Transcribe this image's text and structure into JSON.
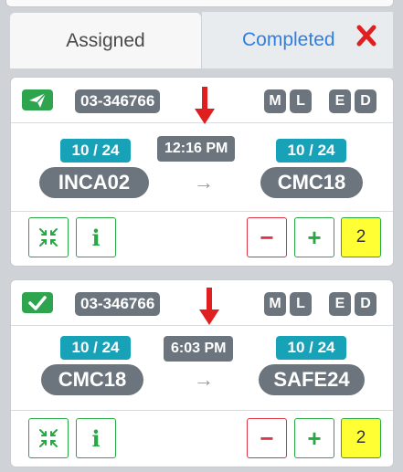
{
  "tabs": {
    "assigned": "Assigned",
    "completed": "Completed"
  },
  "colors": {
    "accent_blue": "#2f7fe0",
    "close_red": "#e02020",
    "status_green": "#2ea44f",
    "badge_gray": "#6c757d",
    "count_teal": "#17a2b8",
    "counter_yellow": "#ffff33"
  },
  "cards": [
    {
      "status_icon": "paper-plane-icon",
      "id": "03-346766",
      "flags": [
        "M",
        "L",
        "E",
        "D"
      ],
      "origin_count": "10 / 24",
      "origin": "INCA02",
      "time": "12:16 PM",
      "dest_count": "10 / 24",
      "destination": "CMC18",
      "counter": "2"
    },
    {
      "status_icon": "checkmark-icon",
      "id": "03-346766",
      "flags": [
        "M",
        "L",
        "E",
        "D"
      ],
      "origin_count": "10 / 24",
      "origin": "CMC18",
      "time": "6:03 PM",
      "dest_count": "10 / 24",
      "destination": "SAFE24",
      "counter": "2"
    }
  ],
  "icons": {
    "close": "close-x-icon",
    "arrow_down": "red-down-arrow-icon",
    "route_arrow": "right-arrow-icon",
    "compress": "compress-arrows-icon",
    "info": "info-icon",
    "minus": "minus-icon",
    "plus": "plus-icon"
  },
  "route_arrow_glyph": "→",
  "minus_glyph": "−",
  "plus_glyph": "+",
  "info_glyph": "i"
}
